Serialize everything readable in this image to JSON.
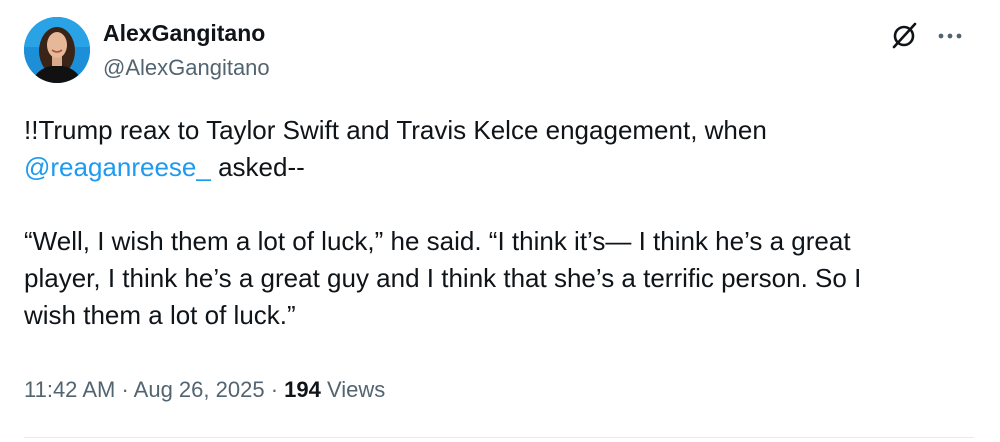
{
  "author": {
    "display_name": "AlexGangitano",
    "handle": "@AlexGangitano"
  },
  "icons": {
    "grok": "grok-icon",
    "more": "more-options-icon"
  },
  "tweet": {
    "line1": "!!Trump reax to Taylor Swift and Travis Kelce engagement, when",
    "mention": "@reaganreese_",
    "line2_rest": " asked--",
    "quote_line1": "“Well, I wish them a lot of luck,” he said. “I think it’s— I think he’s a great",
    "quote_line2": "player, I think he’s a great guy and I think that she’s a terrific person. So I",
    "quote_line3": "wish them a lot of luck.”"
  },
  "meta": {
    "time": "11:42 AM",
    "separator": " · ",
    "date": "Aug 26, 2025",
    "views_count": "194",
    "views_label": " Views"
  },
  "colors": {
    "link": "#1d9bf0",
    "secondary_text": "#536471",
    "primary_text": "#0f1419"
  }
}
